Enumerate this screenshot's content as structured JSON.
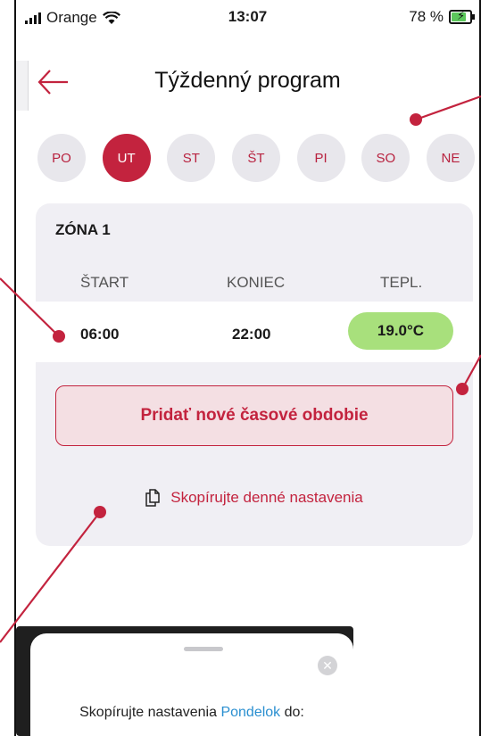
{
  "status_bar": {
    "carrier": "Orange",
    "time": "13:07",
    "battery": "78 %"
  },
  "header": {
    "title": "Týždenný program",
    "back_icon": "arrow-left-icon"
  },
  "days": [
    {
      "label": "PO",
      "active": false
    },
    {
      "label": "UT",
      "active": true
    },
    {
      "label": "ST",
      "active": false
    },
    {
      "label": "ŠT",
      "active": false
    },
    {
      "label": "PI",
      "active": false
    },
    {
      "label": "SO",
      "active": false
    },
    {
      "label": "NE",
      "active": false
    }
  ],
  "zone": {
    "title": "ZÓNA 1",
    "columns": {
      "start": "ŠTART",
      "end": "KONIEC",
      "temp": "TEPL."
    },
    "periods": [
      {
        "start": "06:00",
        "end": "22:00",
        "temp": "19.0°C"
      }
    ],
    "add_button": "Pridať nové časové obdobie",
    "copy_link": "Skopírujte denné nastavenia",
    "copy_icon": "copy-document-icon"
  },
  "sheet": {
    "text_prefix": "Skopírujte nastavenia",
    "day_name": "Pondelok",
    "text_suffix": "do:",
    "close_icon": "close-icon"
  },
  "colors": {
    "accent": "#c3233e",
    "temp_badge": "#a8e07c",
    "card_bg": "#f0eff4",
    "day_bg": "#e8e7ec",
    "link_blue": "#2a8fd0"
  }
}
